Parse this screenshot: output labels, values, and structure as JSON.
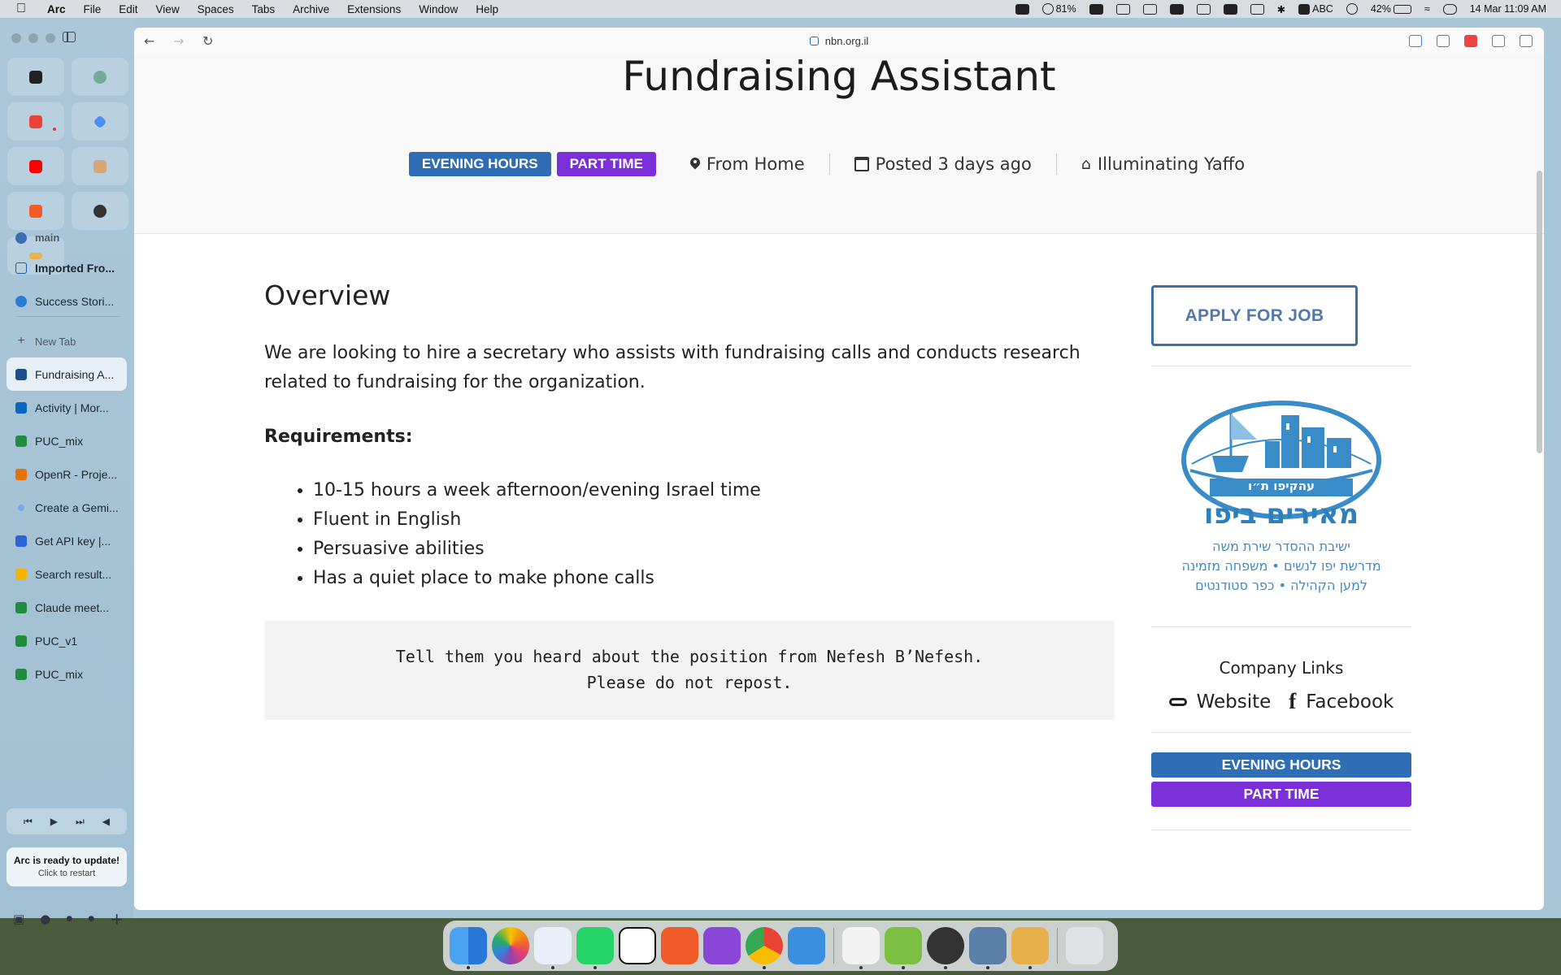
{
  "menubar": {
    "app_name": "Arc",
    "items": [
      "File",
      "Edit",
      "View",
      "Spaces",
      "Tabs",
      "Archive",
      "Extensions",
      "Window",
      "Help"
    ],
    "battery_small": "81%",
    "keyboard": "ABC",
    "battery": "42%",
    "datetime": "14 Mar  11:09 AM"
  },
  "sidebar": {
    "space_label": "main",
    "pinned": [
      "Imported Fro...",
      "Success Stori..."
    ],
    "new_tab": "New Tab",
    "tabs": [
      {
        "label": "Fundraising A...",
        "color": "#1f4e8c",
        "active": true
      },
      {
        "label": "Activity | Mor...",
        "color": "#0a66c2",
        "active": false
      },
      {
        "label": "PUC_mix",
        "color": "#1e8e3e",
        "active": false
      },
      {
        "label": "OpenR - Proje...",
        "color": "#e8710a",
        "active": false
      },
      {
        "label": "Create a Gemi...",
        "color": "#7aa7e8",
        "active": false
      },
      {
        "label": "Get API key |...",
        "color": "#2b63d9",
        "active": false
      },
      {
        "label": "Search result...",
        "color": "#f4b400",
        "active": false
      },
      {
        "label": "Claude meet...",
        "color": "#1e8e3e",
        "active": false
      },
      {
        "label": "PUC_v1",
        "color": "#1e8e3e",
        "active": false
      },
      {
        "label": "PUC_mix",
        "color": "#1e8e3e",
        "active": false
      }
    ],
    "update_title": "Arc is ready to update!",
    "update_sub": "Click to restart"
  },
  "browser": {
    "url": "nbn.org.il"
  },
  "job": {
    "title": "Fundraising Assistant",
    "tag_evening": "EVENING HOURS",
    "tag_part_time": "PART TIME",
    "location": "From Home",
    "posted": "Posted 3 days ago",
    "company": "Illuminating Yaffo",
    "overview_heading": "Overview",
    "description": "We are looking to hire a secretary who assists with fundraising calls and conducts research related to fundraising for the organization.",
    "requirements_heading": "Requirements:",
    "requirements": [
      "10-15 hours a week afternoon/evening Israel time",
      "Fluent in English",
      "Persuasive abilities",
      "Has a quiet place to make phone calls"
    ],
    "notice_line1": "Tell them you heard about the position from Nefesh B’Nefesh.",
    "notice_line2": "Please do not repost."
  },
  "sidebar_right": {
    "apply_label": "APPLY FOR JOB",
    "logo_arc_text": "עהקיפו ת״ו",
    "logo_name": "מאירים ביפו",
    "logo_line1": "ישיבת ההסדר שירת משה",
    "logo_line2": "מדרשת יפו לנשים • משפחה מזמינה",
    "logo_line3": "למען הקהילה • כפר סטודנטים",
    "company_links_heading": "Company Links",
    "website_label": "Website",
    "facebook_label": "Facebook",
    "tag_evening": "EVENING HOURS",
    "tag_part_time": "PART TIME"
  },
  "colors": {
    "evening_tag": "#2f6eb5",
    "part_time_tag": "#7b2fd9",
    "apply_border": "#3c6fa8",
    "logo_blue": "#3a8cc8"
  }
}
